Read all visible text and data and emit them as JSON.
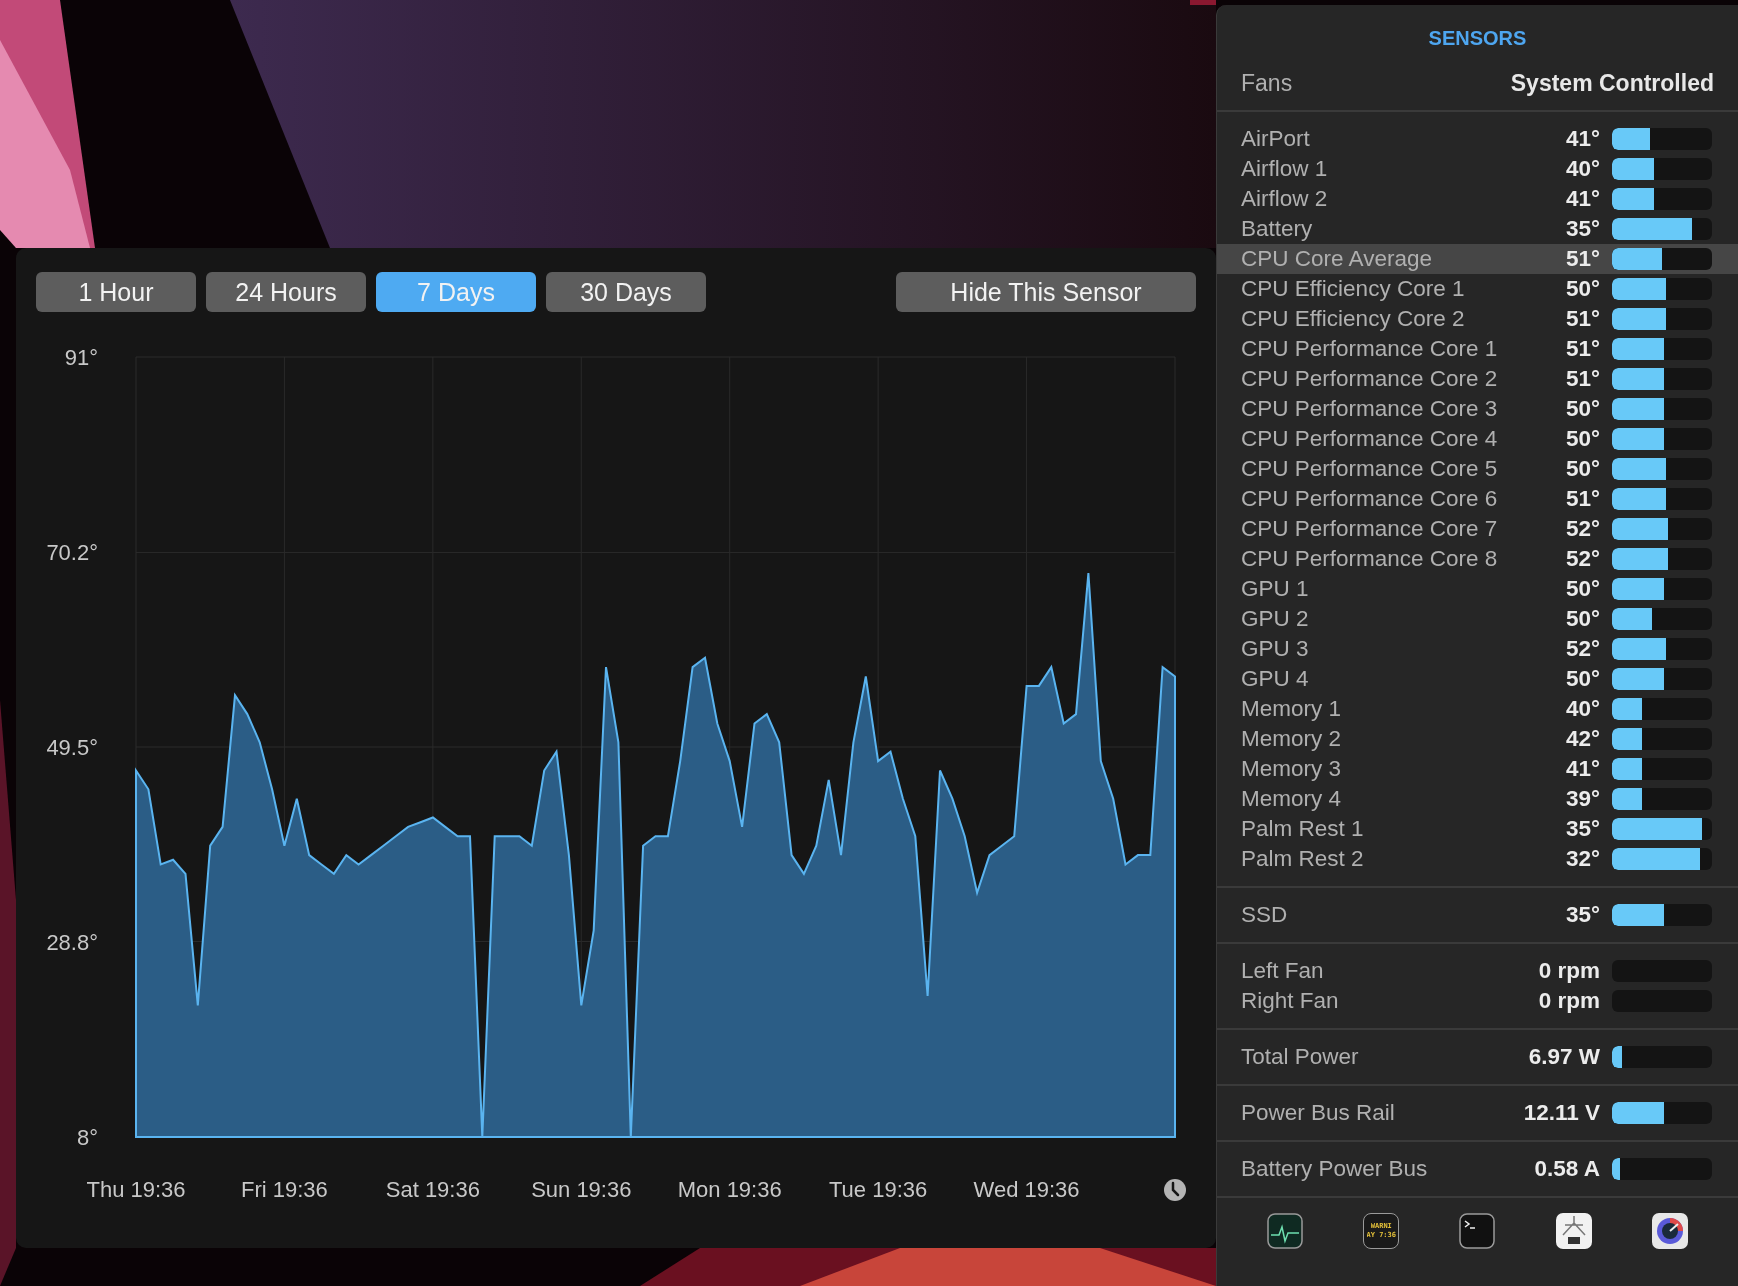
{
  "chart_window": {
    "ranges": [
      {
        "label": "1 Hour",
        "selected": false
      },
      {
        "label": "24 Hours",
        "selected": false
      },
      {
        "label": "7 Days",
        "selected": true
      },
      {
        "label": "30 Days",
        "selected": false
      }
    ],
    "hide_button": "Hide This Sensor",
    "chart_data": {
      "type": "area",
      "grid": true,
      "ylim": [
        8,
        91
      ],
      "yticks": [
        {
          "value": 91,
          "label": "91°"
        },
        {
          "value": 70.2,
          "label": "70.2°"
        },
        {
          "value": 49.5,
          "label": "49.5°"
        },
        {
          "value": 28.8,
          "label": "28.8°"
        },
        {
          "value": 8,
          "label": "8°"
        }
      ],
      "categories": [
        "Thu 19:36",
        null,
        null,
        null,
        null,
        null,
        null,
        null,
        null,
        null,
        null,
        null,
        "Fri 19:36",
        null,
        null,
        null,
        null,
        null,
        null,
        null,
        null,
        null,
        null,
        null,
        "Sat 19:36",
        null,
        null,
        null,
        null,
        null,
        null,
        null,
        null,
        null,
        null,
        null,
        "Sun 19:36",
        null,
        null,
        null,
        null,
        null,
        null,
        null,
        null,
        null,
        null,
        null,
        "Mon 19:36",
        null,
        null,
        null,
        null,
        null,
        null,
        null,
        null,
        null,
        null,
        null,
        "Tue 19:36",
        null,
        null,
        null,
        null,
        null,
        null,
        null,
        null,
        null,
        null,
        null,
        "Wed 19:36",
        null,
        null,
        null,
        null,
        null,
        null,
        null,
        null,
        null,
        null,
        null,
        null
      ],
      "series": [
        {
          "color": "#5ab4f0",
          "values": [
            47,
            45,
            37,
            37.5,
            36,
            22,
            39,
            41,
            55,
            53,
            50,
            45,
            39,
            44,
            38,
            37,
            36,
            38,
            37,
            38,
            39,
            40,
            41,
            41.5,
            42,
            41,
            40,
            40,
            8,
            40,
            40,
            40,
            39,
            47,
            49,
            38,
            22,
            30,
            58,
            50,
            8,
            39,
            40,
            40,
            48,
            58,
            59,
            52,
            48,
            41,
            52,
            53,
            50,
            38,
            36,
            39,
            46,
            38,
            50,
            57,
            48,
            49,
            44,
            40,
            23,
            47,
            44,
            40,
            34,
            38,
            39,
            40,
            56,
            56,
            58,
            52,
            53,
            68,
            48,
            44,
            37,
            38,
            38,
            58,
            57
          ]
        }
      ]
    }
  },
  "panel": {
    "title": "SENSORS",
    "fans_mode": {
      "label": "Fans",
      "value": "System Controlled"
    },
    "groups": [
      {
        "rows": [
          {
            "name": "AirPort",
            "value": "41°",
            "level": 0.38,
            "selected": false
          },
          {
            "name": "Airflow 1",
            "value": "40°",
            "level": 0.42,
            "selected": false
          },
          {
            "name": "Airflow 2",
            "value": "41°",
            "level": 0.42,
            "selected": false
          },
          {
            "name": "Battery",
            "value": "35°",
            "level": 0.8,
            "selected": false
          },
          {
            "name": "CPU Core Average",
            "value": "51°",
            "level": 0.5,
            "selected": true
          },
          {
            "name": "CPU Efficiency Core 1",
            "value": "50°",
            "level": 0.54,
            "selected": false
          },
          {
            "name": "CPU Efficiency Core 2",
            "value": "51°",
            "level": 0.54,
            "selected": false
          },
          {
            "name": "CPU Performance Core 1",
            "value": "51°",
            "level": 0.52,
            "selected": false
          },
          {
            "name": "CPU Performance Core 2",
            "value": "51°",
            "level": 0.52,
            "selected": false
          },
          {
            "name": "CPU Performance Core 3",
            "value": "50°",
            "level": 0.52,
            "selected": false
          },
          {
            "name": "CPU Performance Core 4",
            "value": "50°",
            "level": 0.52,
            "selected": false
          },
          {
            "name": "CPU Performance Core 5",
            "value": "50°",
            "level": 0.54,
            "selected": false
          },
          {
            "name": "CPU Performance Core 6",
            "value": "51°",
            "level": 0.54,
            "selected": false
          },
          {
            "name": "CPU Performance Core 7",
            "value": "52°",
            "level": 0.56,
            "selected": false
          },
          {
            "name": "CPU Performance Core 8",
            "value": "52°",
            "level": 0.56,
            "selected": false
          },
          {
            "name": "GPU 1",
            "value": "50°",
            "level": 0.52,
            "selected": false
          },
          {
            "name": "GPU 2",
            "value": "50°",
            "level": 0.4,
            "selected": false
          },
          {
            "name": "GPU 3",
            "value": "52°",
            "level": 0.54,
            "selected": false
          },
          {
            "name": "GPU 4",
            "value": "50°",
            "level": 0.52,
            "selected": false
          },
          {
            "name": "Memory 1",
            "value": "40°",
            "level": 0.3,
            "selected": false
          },
          {
            "name": "Memory 2",
            "value": "42°",
            "level": 0.3,
            "selected": false
          },
          {
            "name": "Memory 3",
            "value": "41°",
            "level": 0.3,
            "selected": false
          },
          {
            "name": "Memory 4",
            "value": "39°",
            "level": 0.3,
            "selected": false
          },
          {
            "name": "Palm Rest 1",
            "value": "35°",
            "level": 0.9,
            "selected": false
          },
          {
            "name": "Palm Rest 2",
            "value": "32°",
            "level": 0.88,
            "selected": false
          }
        ]
      },
      {
        "rows": [
          {
            "name": "SSD",
            "value": "35°",
            "level": 0.52,
            "selected": false
          }
        ]
      },
      {
        "rows": [
          {
            "name": "Left Fan",
            "value": "0 rpm",
            "selected": false
          },
          {
            "name": "Right Fan",
            "value": "0 rpm",
            "selected": false
          }
        ]
      },
      {
        "rows": [
          {
            "name": "Total Power",
            "value": "6.97 W",
            "level": 0.1,
            "selected": false
          }
        ]
      },
      {
        "rows": [
          {
            "name": "Power Bus Rail",
            "value": "12.11 V",
            "level": 0.52,
            "selected": false
          }
        ]
      },
      {
        "rows": [
          {
            "name": "Battery Power Bus",
            "value": "0.58 A",
            "level": 0.08,
            "selected": false
          }
        ]
      }
    ]
  },
  "toolbar": {
    "icons": [
      {
        "kind": "activity"
      },
      {
        "kind": "console",
        "lines": [
          "WARNI",
          "AY 7:36"
        ]
      },
      {
        "kind": "terminal"
      },
      {
        "kind": "caliper"
      },
      {
        "kind": "gauge"
      }
    ]
  }
}
